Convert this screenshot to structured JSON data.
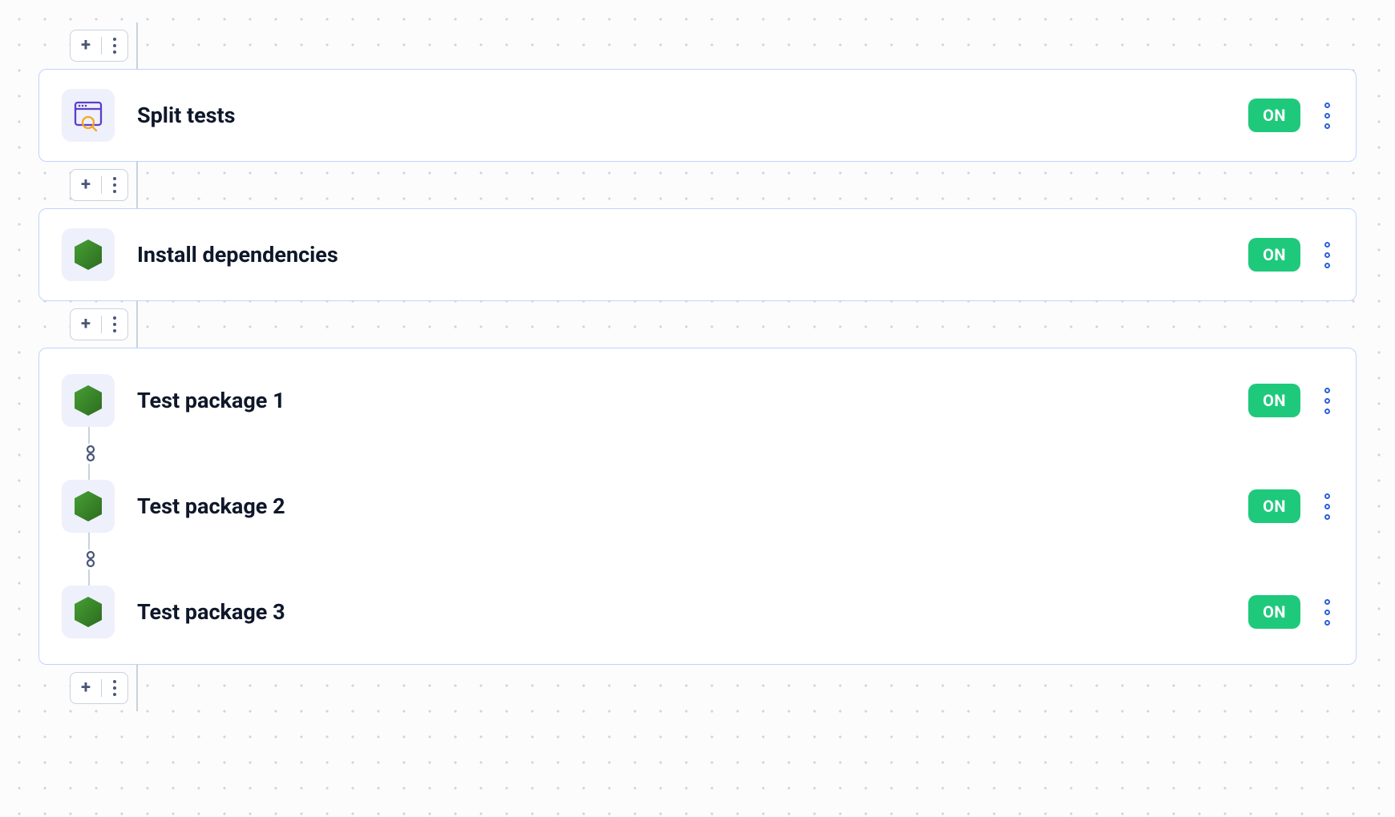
{
  "status": {
    "on_label": "ON"
  },
  "steps": [
    {
      "title": "Split tests",
      "icon": "script",
      "status": "on"
    },
    {
      "title": "Install dependencies",
      "icon": "node",
      "status": "on"
    }
  ],
  "group": {
    "items": [
      {
        "title": "Test package 1",
        "icon": "node",
        "status": "on"
      },
      {
        "title": "Test package 2",
        "icon": "node",
        "status": "on"
      },
      {
        "title": "Test package 3",
        "icon": "node",
        "status": "on"
      }
    ]
  }
}
